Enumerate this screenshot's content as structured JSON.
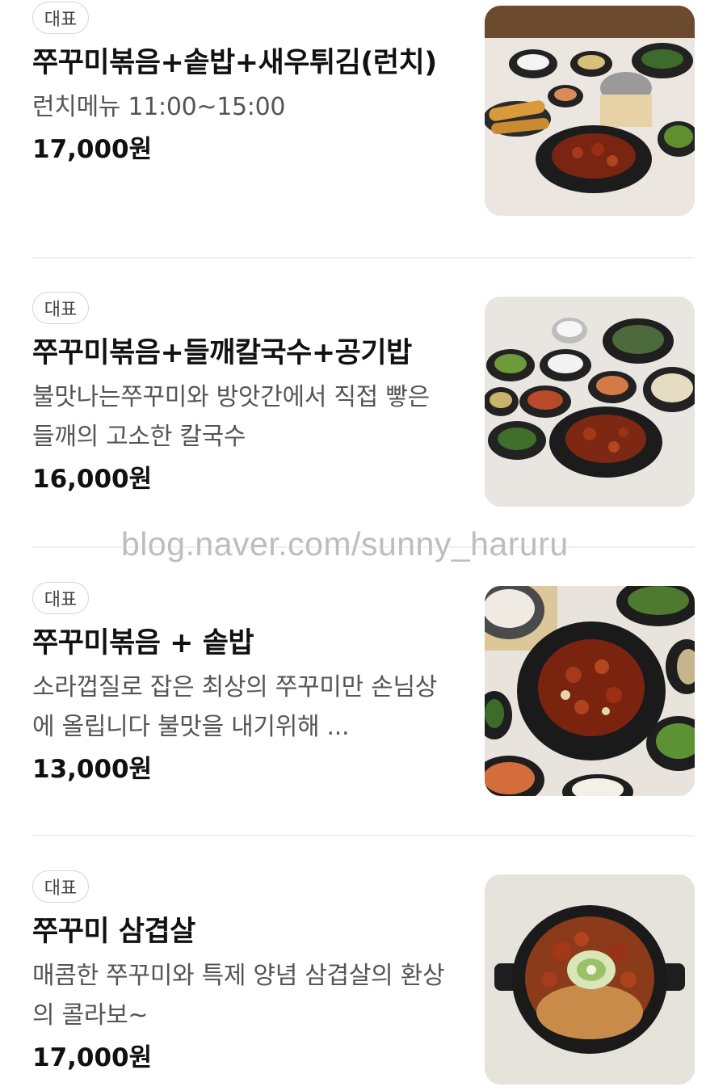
{
  "menu": {
    "items": [
      {
        "badge": "대표",
        "title": "쭈꾸미볶음+솥밥+새우튀김(런치)",
        "description": "런치메뉴 11:00~15:00",
        "price": "17,000원",
        "image_icon": "lunch-set-photo"
      },
      {
        "badge": "대표",
        "title": "쭈꾸미볶음+들깨칼국수+공기밥",
        "description": "불맛나는쭈꾸미와 방앗간에서 직접 빻은 들깨의 고소한 칼국수",
        "price": "16,000원",
        "image_icon": "kalguksu-set-photo"
      },
      {
        "badge": "대표",
        "title": "쭈꾸미볶음 + 솥밥",
        "description": "소라껍질로 잡은 최상의 쭈꾸미만 손님상에 올립니다 불맛을 내기위해 ...",
        "price": "13,000원",
        "image_icon": "stirfry-pot-rice-photo"
      },
      {
        "badge": "대표",
        "title": "쭈꾸미 삼겹살",
        "description": "매콤한 쭈꾸미와 특제 양념 삼겹살의 환상의 콜라보~",
        "price": "17,000원",
        "image_icon": "samgyeopsal-pan-photo"
      }
    ]
  },
  "watermark": "blog.naver.com/sunny_haruru",
  "colors": {
    "text": "#111111",
    "description": "#555555",
    "badge_border": "#d6d6d6",
    "divider": "#eeeeee",
    "watermark": "#bdbdbd"
  }
}
